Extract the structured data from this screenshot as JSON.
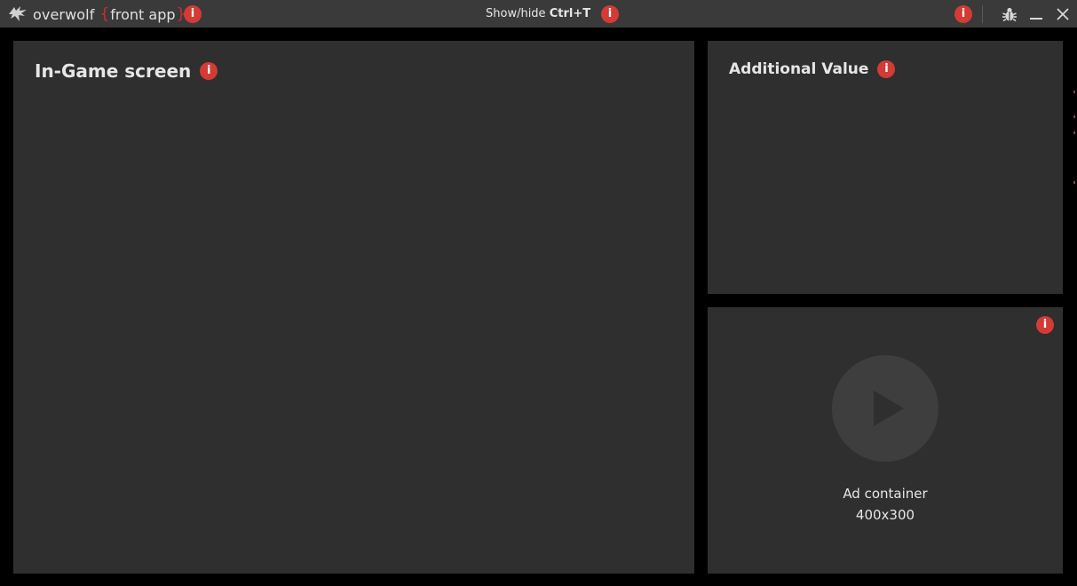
{
  "titlebar": {
    "brand_name": "overwolf",
    "brace_open": "{",
    "brand_sub": "front app",
    "brace_close": "}",
    "hint_prefix": "Show/hide",
    "hint_shortcut": "Ctrl+T",
    "info_glyph": "i",
    "icons": {
      "logo": "overwolf-logo-icon",
      "bug": "bug-icon",
      "minimize": "minimize-icon",
      "close": "close-icon"
    }
  },
  "main_panel": {
    "title": "In-Game screen"
  },
  "value_panel": {
    "title": "Additional Value"
  },
  "ad_panel": {
    "label_line1": "Ad container",
    "label_line2": "400x300",
    "icon": "play-icon"
  },
  "colors": {
    "background": "#000000",
    "titlebar": "#3a3a3a",
    "panel": "#2f2f2f",
    "accent_red": "#d33b34",
    "text": "#e6e6e6"
  }
}
